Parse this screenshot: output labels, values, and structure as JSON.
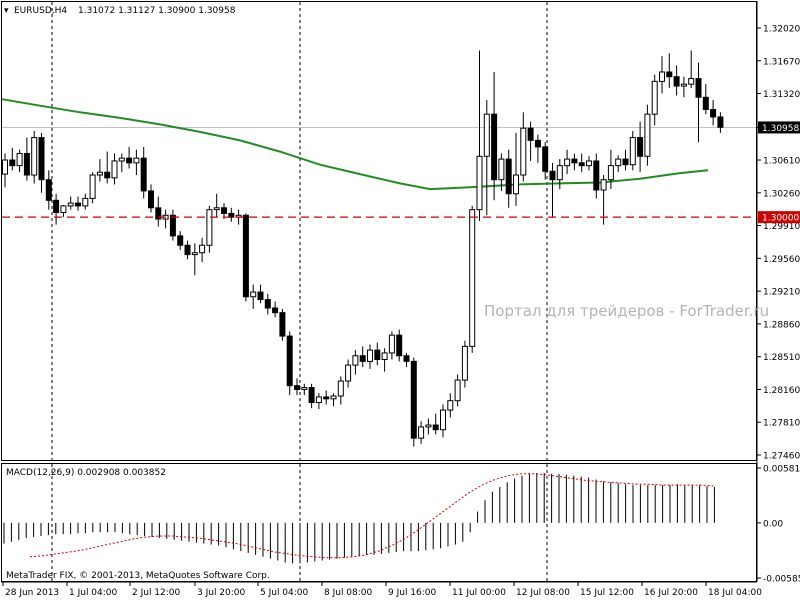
{
  "header": {
    "symbol": "EURUSD,H4",
    "ohlc": "1.31072 1.31127 1.30900 1.30958",
    "macd": "MACD(12,26,9) 0.002908 0.003852"
  },
  "watermark": "Портал для трейдеров - ForTrader.ru",
  "footer": "MetaTrader FIX, © 2001-2013, MetaQuotes Software Corp.",
  "colors": {
    "bull": "#ffffff",
    "bear": "#000000",
    "ma": "#228b22",
    "level": "#cc0000",
    "signal": "#cc0000",
    "histogram": "#000000",
    "bid_line": "#c0c0c0"
  },
  "chart_data": {
    "type": "candlestick",
    "symbol": "EURUSD",
    "timeframe": "H4",
    "ylim": [
      1.2746,
      1.3202
    ],
    "price_ticks": [
      "1.32020",
      "1.31670",
      "1.31320",
      "1.30958",
      "1.30610",
      "1.30260",
      "1.29910",
      "1.29560",
      "1.29210",
      "1.28860",
      "1.28510",
      "1.28160",
      "1.27810",
      "1.27460"
    ],
    "level_label": "1.30000",
    "level_value": 1.3,
    "bid_value": 1.30958,
    "time_labels": [
      "28 Jun 2013",
      "1 Jul 04:00",
      "2 Jul 12:00",
      "3 Jul 20:00",
      "5 Jul 04:00",
      "8 Jul 08:00",
      "9 Jul 16:00",
      "11 Jul 00:00",
      "12 Jul 08:00",
      "15 Jul 12:00",
      "16 Jul 20:00",
      "18 Jul 04:00"
    ],
    "candles": [
      [
        1.3046,
        1.3068,
        1.3032,
        1.3061
      ],
      [
        1.3061,
        1.3074,
        1.305,
        1.3055
      ],
      [
        1.3055,
        1.3072,
        1.3048,
        1.3068
      ],
      [
        1.3068,
        1.3085,
        1.3039,
        1.3045
      ],
      [
        1.3045,
        1.3092,
        1.3036,
        1.3085
      ],
      [
        1.3085,
        1.309,
        1.3026,
        1.304
      ],
      [
        1.304,
        1.305,
        1.3008,
        1.3018
      ],
      [
        1.3018,
        1.3025,
        1.2992,
        1.3005
      ],
      [
        1.3005,
        1.3013,
        1.3,
        1.3012
      ],
      [
        1.3012,
        1.3022,
        1.3008,
        1.3015
      ],
      [
        1.3015,
        1.3022,
        1.3007,
        1.3012
      ],
      [
        1.3012,
        1.3025,
        1.3008,
        1.302
      ],
      [
        1.302,
        1.3048,
        1.3015,
        1.3045
      ],
      [
        1.3045,
        1.3062,
        1.3038,
        1.3048
      ],
      [
        1.3048,
        1.307,
        1.3036,
        1.3042
      ],
      [
        1.3042,
        1.3068,
        1.3035,
        1.306
      ],
      [
        1.306,
        1.3068,
        1.3048,
        1.3063
      ],
      [
        1.3063,
        1.3075,
        1.3052,
        1.3058
      ],
      [
        1.3058,
        1.3072,
        1.3045,
        1.3063
      ],
      [
        1.3063,
        1.3075,
        1.302,
        1.3028
      ],
      [
        1.3028,
        1.3035,
        1.3005,
        1.301
      ],
      [
        1.301,
        1.3022,
        1.299,
        1.2998
      ],
      [
        1.2998,
        1.3008,
        1.2988,
        1.3002
      ],
      [
        1.3002,
        1.3008,
        1.2975,
        1.298
      ],
      [
        1.298,
        1.2985,
        1.2965,
        1.297
      ],
      [
        1.297,
        1.2975,
        1.2955,
        1.296
      ],
      [
        1.296,
        1.2972,
        1.2938,
        1.2962
      ],
      [
        1.2962,
        1.2978,
        1.2952,
        1.297
      ],
      [
        1.297,
        1.3012,
        1.2962,
        1.3008
      ],
      [
        1.3008,
        1.3025,
        1.3,
        1.301
      ],
      [
        1.301,
        1.3015,
        1.2998,
        1.3004
      ],
      [
        1.3004,
        1.301,
        1.2995,
        1.3
      ],
      [
        1.3,
        1.3008,
        1.2992,
        1.3002
      ],
      [
        1.3002,
        1.3004,
        1.291,
        1.2915
      ],
      [
        1.2915,
        1.2928,
        1.2902,
        1.292
      ],
      [
        1.292,
        1.2928,
        1.2908,
        1.2912
      ],
      [
        1.2912,
        1.2918,
        1.2896,
        1.2903
      ],
      [
        1.2903,
        1.291,
        1.2893,
        1.2898
      ],
      [
        1.2898,
        1.2902,
        1.2868,
        1.2873
      ],
      [
        1.2873,
        1.2878,
        1.281,
        1.282
      ],
      [
        1.282,
        1.2828,
        1.281,
        1.2816
      ],
      [
        1.2816,
        1.2822,
        1.281,
        1.2818
      ],
      [
        1.2818,
        1.2822,
        1.2796,
        1.2802
      ],
      [
        1.2802,
        1.2812,
        1.2795,
        1.2808
      ],
      [
        1.2808,
        1.2815,
        1.28,
        1.2806
      ],
      [
        1.2806,
        1.2812,
        1.2798,
        1.2809
      ],
      [
        1.2809,
        1.283,
        1.28,
        1.2825
      ],
      [
        1.2825,
        1.2848,
        1.2818,
        1.2842
      ],
      [
        1.2842,
        1.2858,
        1.2832,
        1.2852
      ],
      [
        1.2852,
        1.2862,
        1.284,
        1.2846
      ],
      [
        1.2846,
        1.2864,
        1.2838,
        1.2858
      ],
      [
        1.2858,
        1.2866,
        1.2842,
        1.2848
      ],
      [
        1.2848,
        1.286,
        1.2835,
        1.2855
      ],
      [
        1.2855,
        1.2878,
        1.2848,
        1.2874
      ],
      [
        1.2874,
        1.288,
        1.2846,
        1.2852
      ],
      [
        1.2852,
        1.2855,
        1.284,
        1.2846
      ],
      [
        1.2846,
        1.285,
        1.2755,
        1.2764
      ],
      [
        1.2764,
        1.2782,
        1.2758,
        1.2776
      ],
      [
        1.2776,
        1.2785,
        1.2768,
        1.2778
      ],
      [
        1.2778,
        1.279,
        1.2768,
        1.2773
      ],
      [
        1.2773,
        1.28,
        1.2765,
        1.2794
      ],
      [
        1.2794,
        1.2812,
        1.2786,
        1.2804
      ],
      [
        1.2804,
        1.2832,
        1.2798,
        1.2826
      ],
      [
        1.2826,
        1.2868,
        1.2818,
        1.2862
      ],
      [
        1.2862,
        1.3012,
        1.2855,
        1.3008
      ],
      [
        1.3008,
        1.3178,
        1.2996,
        1.3065
      ],
      [
        1.3065,
        1.3125,
        1.3002,
        1.311
      ],
      [
        1.311,
        1.3155,
        1.3018,
        1.304
      ],
      [
        1.304,
        1.3068,
        1.3028,
        1.3062
      ],
      [
        1.3062,
        1.3072,
        1.301,
        1.3025
      ],
      [
        1.3025,
        1.309,
        1.3012,
        1.3045
      ],
      [
        1.3045,
        1.3112,
        1.3038,
        1.3095
      ],
      [
        1.3095,
        1.3102,
        1.306,
        1.3082
      ],
      [
        1.3082,
        1.3088,
        1.3058,
        1.3075
      ],
      [
        1.3075,
        1.308,
        1.304,
        1.3049
      ],
      [
        1.3049,
        1.3058,
        1.3,
        1.304
      ],
      [
        1.304,
        1.3062,
        1.303,
        1.3055
      ],
      [
        1.3055,
        1.3072,
        1.3046,
        1.3062
      ],
      [
        1.3062,
        1.3068,
        1.305,
        1.3058
      ],
      [
        1.3058,
        1.3068,
        1.3048,
        1.3055
      ],
      [
        1.3055,
        1.3065,
        1.305,
        1.306
      ],
      [
        1.306,
        1.3068,
        1.302,
        1.3029
      ],
      [
        1.3029,
        1.3045,
        1.2992,
        1.304
      ],
      [
        1.304,
        1.3072,
        1.303,
        1.3055
      ],
      [
        1.3055,
        1.3066,
        1.3048,
        1.3062
      ],
      [
        1.3062,
        1.3072,
        1.305,
        1.3056
      ],
      [
        1.3056,
        1.3092,
        1.305,
        1.3085
      ],
      [
        1.3085,
        1.3102,
        1.3048,
        1.3065
      ],
      [
        1.3065,
        1.312,
        1.3055,
        1.311
      ],
      [
        1.311,
        1.3152,
        1.3098,
        1.3145
      ],
      [
        1.3145,
        1.3172,
        1.3132,
        1.3155
      ],
      [
        1.3155,
        1.3175,
        1.3138,
        1.315
      ],
      [
        1.315,
        1.3162,
        1.313,
        1.314
      ],
      [
        1.314,
        1.315,
        1.3128,
        1.3142
      ],
      [
        1.3142,
        1.3178,
        1.3138,
        1.3148
      ],
      [
        1.3148,
        1.3165,
        1.308,
        1.3128
      ],
      [
        1.3128,
        1.3142,
        1.311,
        1.3115
      ],
      [
        1.3115,
        1.3125,
        1.3098,
        1.3107
      ],
      [
        1.3107,
        1.3112,
        1.309,
        1.3096
      ]
    ],
    "ma": [
      [
        0,
        1.3126
      ],
      [
        40,
        1.3119
      ],
      [
        80,
        1.3112
      ],
      [
        120,
        1.3106
      ],
      [
        160,
        1.3099
      ],
      [
        200,
        1.3091
      ],
      [
        240,
        1.3082
      ],
      [
        280,
        1.307
      ],
      [
        320,
        1.3056
      ],
      [
        360,
        1.3046
      ],
      [
        400,
        1.3036
      ],
      [
        430,
        1.303
      ],
      [
        470,
        1.3032
      ],
      [
        520,
        1.3035
      ],
      [
        560,
        1.3036
      ],
      [
        600,
        1.3037
      ],
      [
        640,
        1.3041
      ],
      [
        680,
        1.3047
      ],
      [
        708,
        1.305
      ]
    ],
    "macd": {
      "title": "MACD(12,26,9)",
      "main": 0.002908,
      "signal_value": 0.003852,
      "ylim": [
        -0.005852,
        0.005819
      ],
      "ticks": [
        "0.005819",
        "0.00",
        "-0.005852"
      ],
      "histogram": [
        -0.0022,
        -0.002,
        -0.0018,
        -0.0016,
        -0.0015,
        -0.0014,
        -0.0013,
        -0.0012,
        -0.0012,
        -0.0012,
        -0.0011,
        -0.0011,
        -0.001,
        -0.001,
        -0.001,
        -0.001,
        -0.0011,
        -0.0012,
        -0.0013,
        -0.0014,
        -0.0015,
        -0.0016,
        -0.0017,
        -0.0018,
        -0.0019,
        -0.002,
        -0.0021,
        -0.0022,
        -0.0023,
        -0.0024,
        -0.0026,
        -0.0028,
        -0.003,
        -0.0032,
        -0.0034,
        -0.0036,
        -0.0038,
        -0.004,
        -0.0042,
        -0.0043,
        -0.0043,
        -0.0042,
        -0.0041,
        -0.004,
        -0.0039,
        -0.0038,
        -0.0037,
        -0.0036,
        -0.0035,
        -0.0034,
        -0.0034,
        -0.0033,
        -0.0032,
        -0.0031,
        -0.003,
        -0.003,
        -0.003,
        -0.0029,
        -0.0028,
        -0.0027,
        -0.0025,
        -0.0023,
        -0.002,
        -0.001,
        0.0012,
        0.0024,
        0.0033,
        0.0038,
        0.0043,
        0.0047,
        0.005,
        0.0053,
        0.0053,
        0.0053,
        0.0052,
        0.0052,
        0.0051,
        0.005,
        0.0049,
        0.0048,
        0.0046,
        0.0044,
        0.0043,
        0.0042,
        0.0041,
        0.004,
        0.004,
        0.004,
        0.004,
        0.004,
        0.004,
        0.0041,
        0.004,
        0.004,
        0.004,
        0.0039,
        0.0038
      ],
      "signal": [
        -0.0036,
        -0.0035,
        -0.0033,
        -0.0031,
        -0.0029,
        -0.0026,
        -0.0023,
        -0.002,
        -0.0017,
        -0.0015,
        -0.0014,
        -0.0014,
        -0.0015,
        -0.0016,
        -0.0018,
        -0.002,
        -0.0022,
        -0.0025,
        -0.0028,
        -0.0031,
        -0.0033,
        -0.0035,
        -0.0036,
        -0.0037,
        -0.0037,
        -0.0036,
        -0.0034,
        -0.003,
        -0.0024,
        -0.0017,
        -0.0008,
        0.0002,
        0.0012,
        0.0022,
        0.0032,
        0.004,
        0.0046,
        0.005,
        0.0052,
        0.0052,
        0.0051,
        0.0049,
        0.0047,
        0.0045,
        0.0044,
        0.0043,
        0.0042,
        0.0041,
        0.0041,
        0.004,
        0.004,
        0.004,
        0.004,
        0.0039
      ]
    }
  }
}
